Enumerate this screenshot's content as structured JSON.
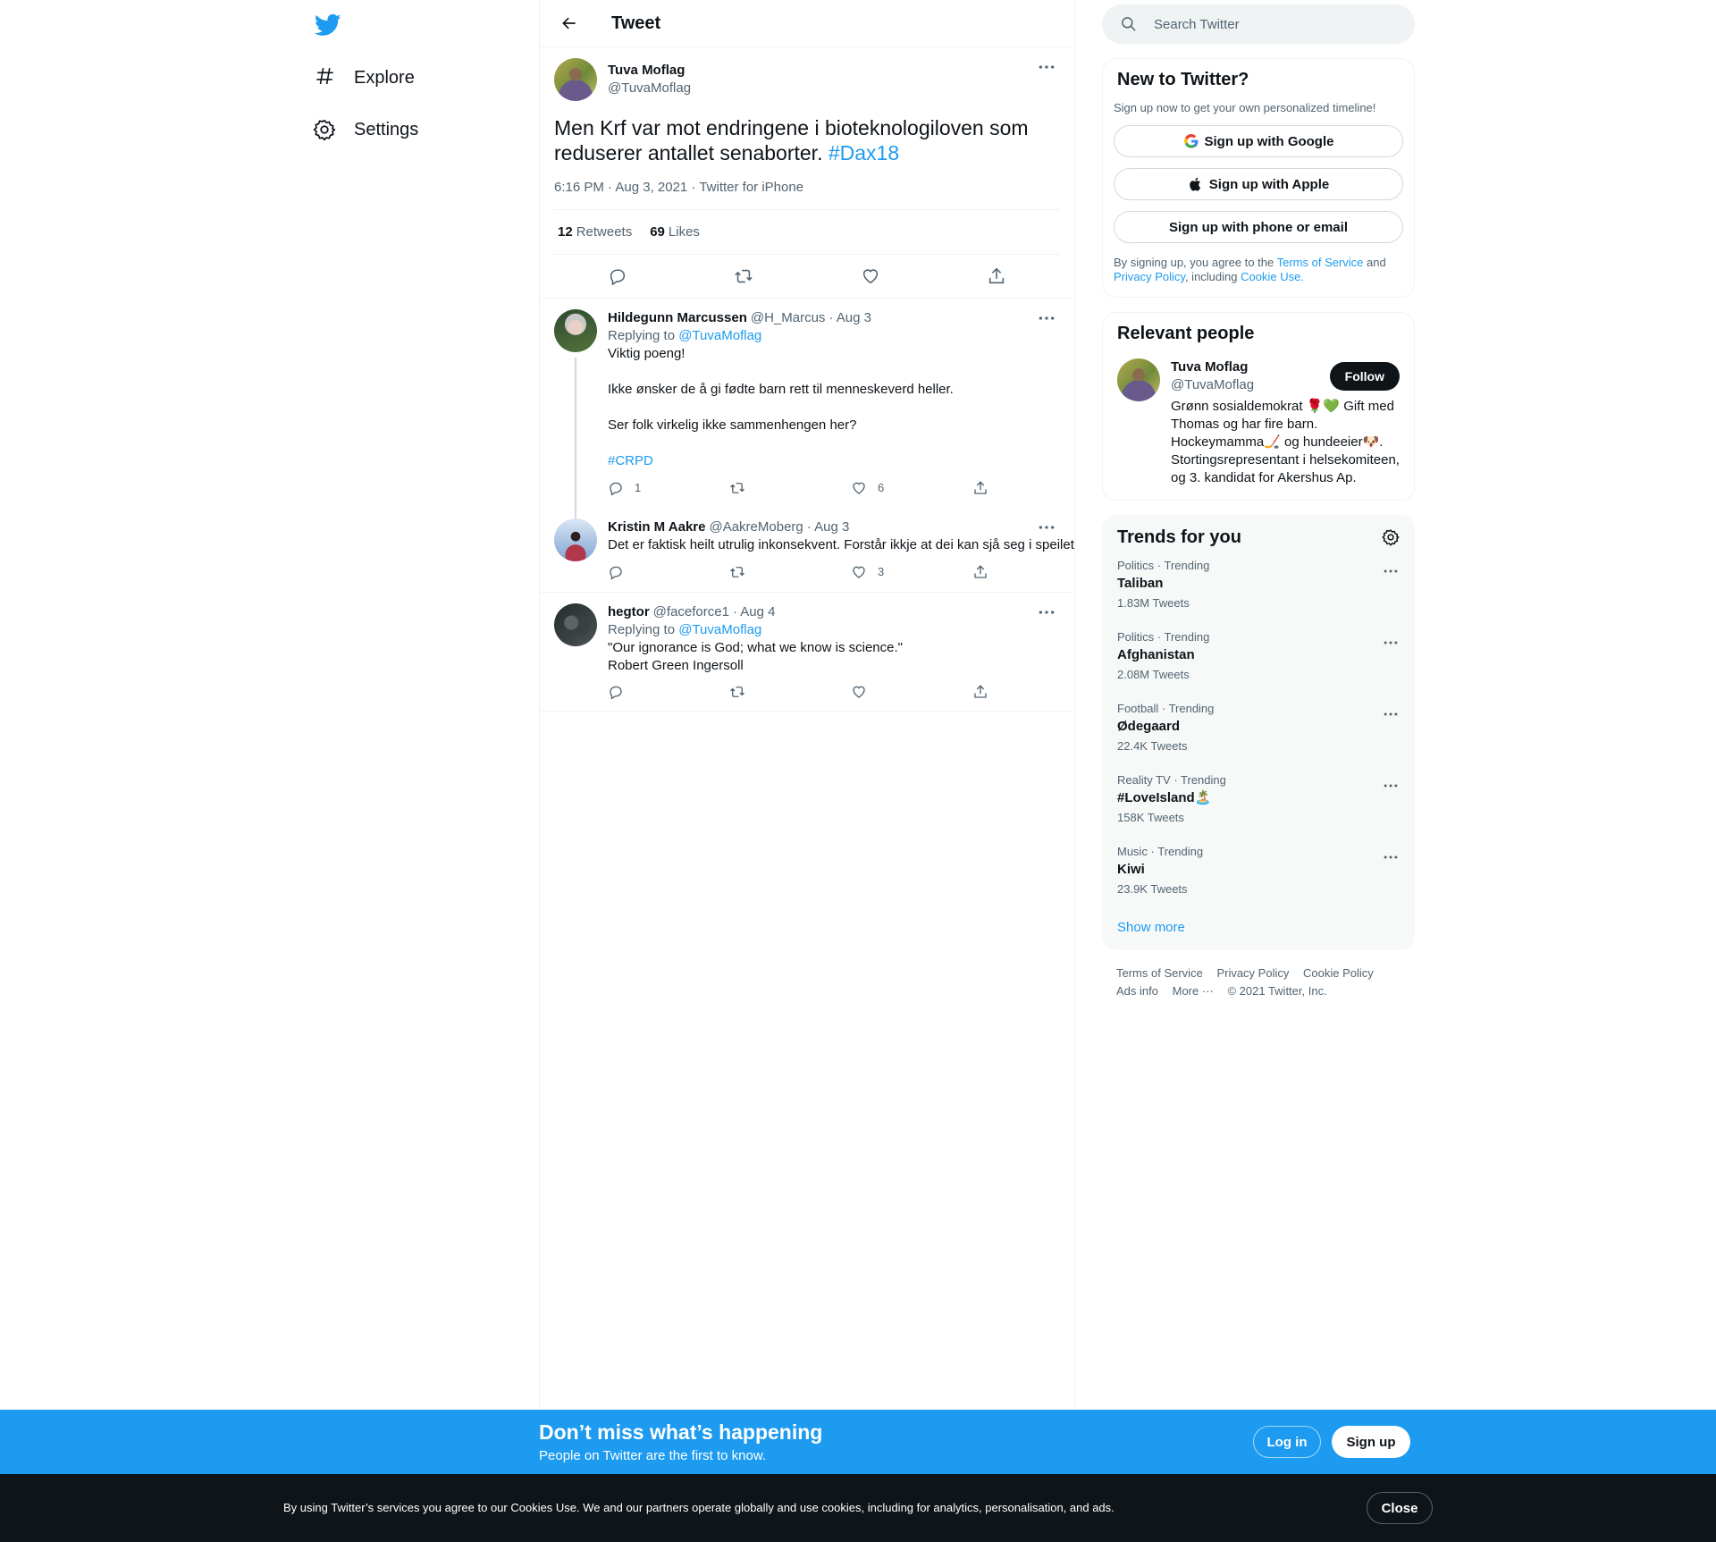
{
  "nav": {
    "explore": "Explore",
    "settings": "Settings"
  },
  "header": {
    "title": "Tweet"
  },
  "main_tweet": {
    "name": "Tuva Moflag",
    "handle": "@TuvaMoflag",
    "text": "Men Krf var mot endringene i bioteknologiloven som reduserer antallet senaborter. ",
    "hashtag": "#Dax18",
    "timestamp": "6:16 PM · Aug 3, 2021 · Twitter for iPhone",
    "retweets": "12",
    "retweets_label": "Retweets",
    "likes": "69",
    "likes_label": "Likes"
  },
  "replies": [
    {
      "name": "Hildegunn Marcussen",
      "handle": "@H_Marcus",
      "date": "· Aug 3",
      "replying_label": "Replying to ",
      "replying_to": "@TuvaMoflag",
      "text": "Viktig poeng!\n\nIkke ønsker de å gi fødte barn rett til menneskeverd heller.\n\nSer folk virkelig ikke sammenhengen her?\n\n",
      "hashtag": "#CRPD",
      "reply_count": "1",
      "retweet_count": "",
      "like_count": "6"
    },
    {
      "name": "Kristin M Aakre",
      "handle": "@AakreMoberg",
      "date": "· Aug 3",
      "text": "Det er faktisk heilt utrulig inkonsekvent. Forstår ikkje at dei kan sjå seg i speilet",
      "reply_count": "",
      "retweet_count": "",
      "like_count": "3"
    },
    {
      "name": "hegtor",
      "handle": "@faceforce1",
      "date": "· Aug 4",
      "replying_label": "Replying to ",
      "replying_to": "@TuvaMoflag",
      "text": "\"Our ignorance is God; what we know is science.\"\nRobert Green Ingersoll",
      "reply_count": "",
      "retweet_count": "",
      "like_count": ""
    }
  ],
  "search": {
    "placeholder": "Search Twitter"
  },
  "new_to_twitter": {
    "title": "New to Twitter?",
    "subtitle": "Sign up now to get your own personalized timeline!",
    "google": "Sign up with Google",
    "apple": "Sign up with Apple",
    "phone": "Sign up with phone or email",
    "legal_1": "By signing up, you agree to the ",
    "terms": "Terms of Service",
    "legal_2": " and ",
    "privacy": "Privacy Policy",
    "legal_3": ", including ",
    "cookie": "Cookie Use."
  },
  "relevant_people": {
    "title": "Relevant people",
    "name": "Tuva Moflag",
    "handle": "@TuvaMoflag",
    "follow": "Follow",
    "bio": "Grønn sosialdemokrat 🌹💚 Gift med Thomas og har fire barn. Hockeymamma🏒 og hundeeier🐶. Stortingsrepresentant i helsekomiteen, og 3. kandidat for Akershus Ap."
  },
  "trends": {
    "title": "Trends for you",
    "items": [
      {
        "meta": "Politics · Trending",
        "name": "Taliban",
        "count": "1.83M Tweets"
      },
      {
        "meta": "Politics · Trending",
        "name": "Afghanistan",
        "count": "2.08M Tweets"
      },
      {
        "meta": "Football · Trending",
        "name": "Ødegaard",
        "count": "22.4K Tweets"
      },
      {
        "meta": "Reality TV · Trending",
        "name": "#LoveIsland🏝️",
        "count": "158K Tweets"
      },
      {
        "meta": "Music · Trending",
        "name": "Kiwi",
        "count": "23.9K Tweets"
      }
    ],
    "show_more": "Show more"
  },
  "footer": {
    "terms": "Terms of Service",
    "privacy": "Privacy Policy",
    "cookie": "Cookie Policy",
    "ads": "Ads info",
    "more": "More ···",
    "copyright": "© 2021 Twitter, Inc."
  },
  "signup_bar": {
    "title": "Don’t miss what’s happening",
    "subtitle": "People on Twitter are the first to know.",
    "login": "Log in",
    "signup": "Sign up"
  },
  "cookie_bar": {
    "text": "By using Twitter’s services you agree to our Cookies Use. We and our partners operate globally and use cookies, including for analytics, personalisation, and ads.",
    "close": "Close"
  },
  "colors": {
    "accent": "#1d9bf0",
    "text": "#0f1419",
    "secondary": "#536471"
  }
}
